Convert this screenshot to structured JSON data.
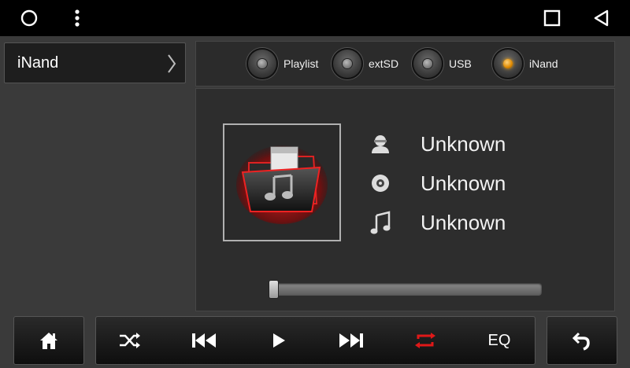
{
  "status_bar": {
    "icons": [
      "circle-icon",
      "more-vertical-icon",
      "square-icon",
      "back-triangle-icon"
    ]
  },
  "sidebar": {
    "items": [
      {
        "label": "iNand",
        "icon": "chevron-right-icon"
      }
    ]
  },
  "source_tabs": [
    {
      "label": "Playlist",
      "active": false
    },
    {
      "label": "extSD",
      "active": false
    },
    {
      "label": "USB",
      "active": false
    },
    {
      "label": "iNand",
      "active": true
    }
  ],
  "track_info": {
    "artist": "Unknown",
    "album": "Unknown",
    "title": "Unknown",
    "artist_icon": "person-icon",
    "album_icon": "disc-icon",
    "title_icon": "music-note-icon"
  },
  "album_art": {
    "icon": "music-folder-icon"
  },
  "progress": {
    "fraction": 0.0
  },
  "controls": {
    "home_icon": "home-icon",
    "shuffle_icon": "shuffle-icon",
    "prev_icon": "skip-previous-icon",
    "play_icon": "play-icon",
    "next_icon": "skip-next-icon",
    "repeat_icon": "repeat-icon",
    "eq_label": "EQ",
    "back_icon": "undo-icon"
  },
  "colors": {
    "active_indicator": "#f0a000",
    "repeat_active": "#e01818",
    "album_glow": "#c00000"
  }
}
